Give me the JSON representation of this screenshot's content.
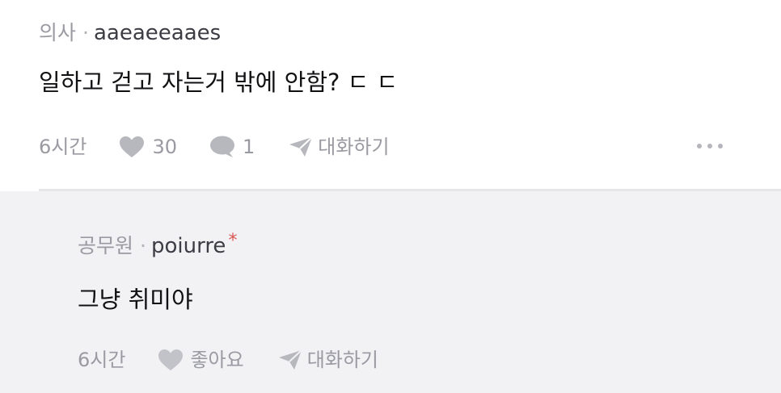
{
  "comment": {
    "job": "의사",
    "separator": "·",
    "nickname": "aaeaeeaaes",
    "text": "일하고 걷고 자는거 밖에 안함? ㄷ ㄷ",
    "time": "6시간",
    "like_count": "30",
    "reply_count": "1",
    "chat_label": "대화하기"
  },
  "reply": {
    "job": "공무원",
    "separator": "·",
    "nickname": "poiurre",
    "badge": "*",
    "text": "그냥 취미야",
    "time": "6시간",
    "like_label": "좋아요",
    "chat_label": "대화하기"
  },
  "colors": {
    "reply_background": "#f2f2f5",
    "meta_gray": "#9a9aa2",
    "badge_red": "#d9534f"
  },
  "icons": [
    "heart-icon",
    "speech-bubble-icon",
    "paper-plane-icon",
    "more-dots-icon"
  ]
}
